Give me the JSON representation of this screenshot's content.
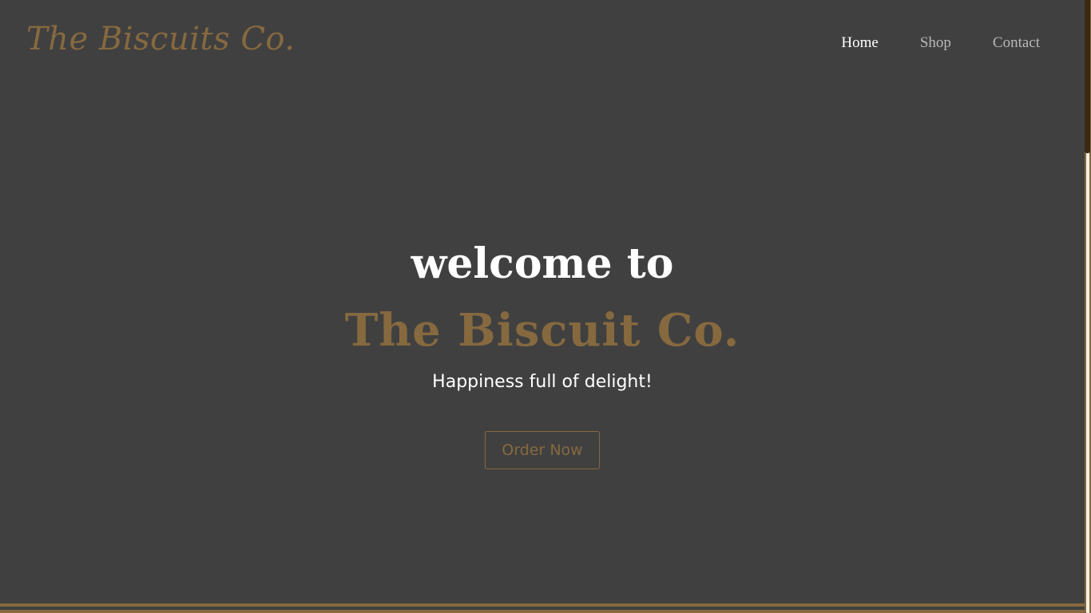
{
  "brand": {
    "logo_text": "The Biscuits Co.",
    "accent_color": "#86693f",
    "background_color": "#404040"
  },
  "nav": {
    "items": [
      {
        "label": "Home",
        "active": true
      },
      {
        "label": "Shop",
        "active": false
      },
      {
        "label": "Contact",
        "active": false
      }
    ]
  },
  "hero": {
    "welcome": "welcome to",
    "title": "The Biscuit Co.",
    "tagline": "Happiness full of delight!",
    "cta_label": "Order Now"
  }
}
